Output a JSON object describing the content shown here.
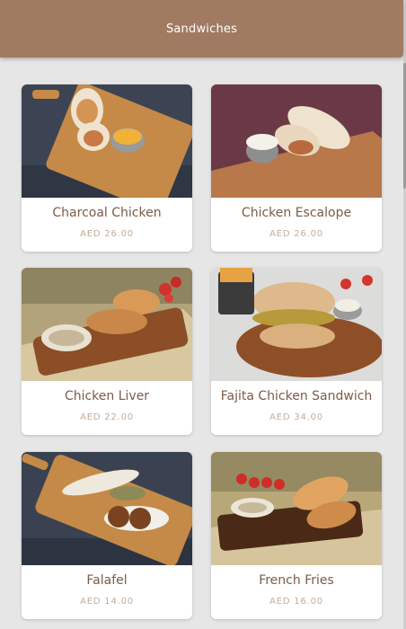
{
  "header": {
    "title": "Sandwiches"
  },
  "items": [
    {
      "name": "Charcoal Chicken",
      "price": "AED 26.00"
    },
    {
      "name": "Chicken Escalope",
      "price": "AED 26.00"
    },
    {
      "name": "Chicken Liver",
      "price": "AED 22.00"
    },
    {
      "name": "Fajita Chicken Sandwich",
      "price": "AED 34.00"
    },
    {
      "name": "Falafel",
      "price": "AED 14.00"
    },
    {
      "name": "French Fries",
      "price": "AED 16.00"
    }
  ],
  "colors": {
    "header": "#a07b62",
    "item_name": "#7b5b46",
    "item_price": "#c4ab97",
    "background": "#e6e6e6"
  }
}
